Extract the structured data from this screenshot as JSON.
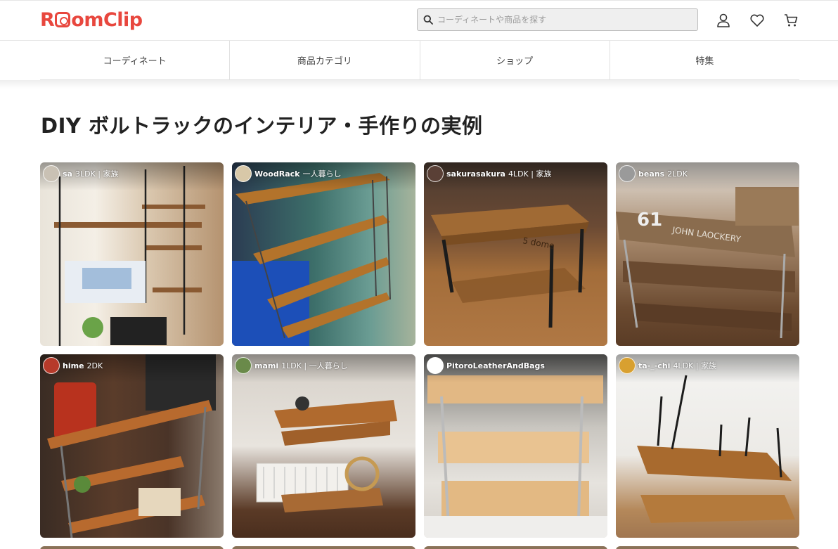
{
  "header": {
    "logo": "RoomClip",
    "search_placeholder": "コーディネートや商品を探す",
    "icons": [
      "user-icon",
      "heart-icon",
      "cart-icon"
    ]
  },
  "nav": [
    "コーディネート",
    "商品カテゴリ",
    "ショップ",
    "特集"
  ],
  "page_title": "DIY ボルトラックのインテリア・手作りの実例",
  "posts": [
    {
      "user": "sa",
      "meta": "3LDK | 家族"
    },
    {
      "user": "WoodRack",
      "meta": "一人暮らし"
    },
    {
      "user": "sakurasakura",
      "meta": "4LDK | 家族"
    },
    {
      "user": "beans",
      "meta": "2LDK"
    },
    {
      "user": "hime",
      "meta": "2DK"
    },
    {
      "user": "mami",
      "meta": "1LDK | 一人暮らし"
    },
    {
      "user": "PitoroLeatherAndBags",
      "meta": ""
    },
    {
      "user": "ta-_-chi",
      "meta": "4LDK | 家族"
    }
  ],
  "colors": {
    "brand": "#e8473e",
    "text": "#333333"
  }
}
